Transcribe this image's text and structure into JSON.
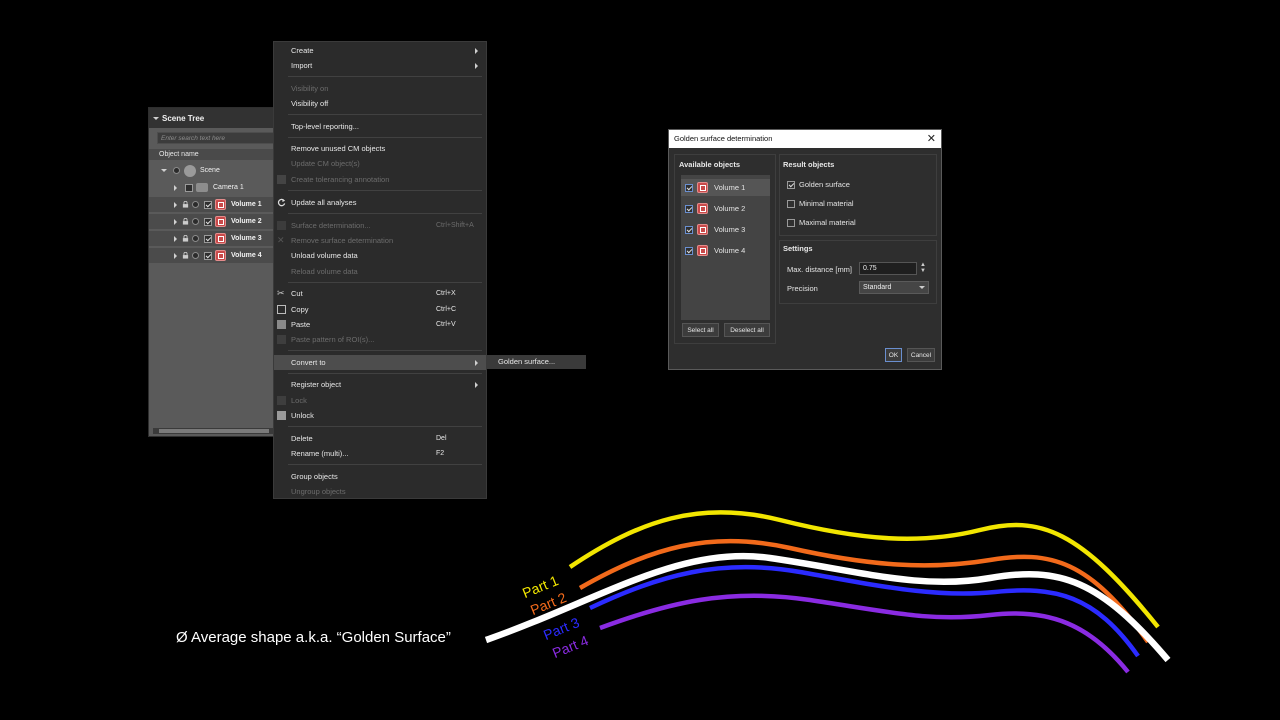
{
  "scene_tree": {
    "title": "Scene Tree",
    "search_placeholder": "Enter search text here",
    "column_header": "Object name",
    "items": [
      {
        "label": "Scene"
      },
      {
        "label": "Camera 1"
      },
      {
        "label": "Volume 1"
      },
      {
        "label": "Volume 2"
      },
      {
        "label": "Volume 3"
      },
      {
        "label": "Volume 4"
      }
    ]
  },
  "context_menu": {
    "items": [
      {
        "label": "Create",
        "submenu": true
      },
      {
        "label": "Import",
        "submenu": true
      },
      {
        "label": "Visibility on",
        "disabled": true
      },
      {
        "label": "Visibility off"
      },
      {
        "label": "Top-level reporting..."
      },
      {
        "label": "Remove unused CM objects"
      },
      {
        "label": "Update CM object(s)",
        "disabled": true
      },
      {
        "label": "Create tolerancing annotation",
        "disabled": true
      },
      {
        "label": "Update all analyses"
      },
      {
        "label": "Surface determination...",
        "shortcut": "Ctrl+Shift+A",
        "disabled": true
      },
      {
        "label": "Remove surface determination",
        "disabled": true
      },
      {
        "label": "Unload volume data"
      },
      {
        "label": "Reload volume data",
        "disabled": true
      },
      {
        "label": "Cut",
        "shortcut": "Ctrl+X"
      },
      {
        "label": "Copy",
        "shortcut": "Ctrl+C"
      },
      {
        "label": "Paste",
        "shortcut": "Ctrl+V"
      },
      {
        "label": "Paste pattern of ROI(s)...",
        "disabled": true
      },
      {
        "label": "Convert to",
        "submenu": true,
        "highlighted": true
      },
      {
        "label": "Register object",
        "submenu": true
      },
      {
        "label": "Lock",
        "disabled": true
      },
      {
        "label": "Unlock"
      },
      {
        "label": "Delete",
        "shortcut": "Del"
      },
      {
        "label": "Rename (multi)...",
        "shortcut": "F2"
      },
      {
        "label": "Group objects"
      },
      {
        "label": "Ungroup objects",
        "disabled": true
      }
    ],
    "submenu_item": "Golden surface..."
  },
  "dialog": {
    "title": "Golden surface determination",
    "available_title": "Available objects",
    "available": [
      "Volume 1",
      "Volume 2",
      "Volume 3",
      "Volume 4"
    ],
    "select_all": "Select all",
    "deselect_all": "Deselect all",
    "result_title": "Result objects",
    "results": [
      {
        "label": "Golden surface",
        "checked": true
      },
      {
        "label": "Minimal material",
        "checked": false
      },
      {
        "label": "Maximal material",
        "checked": false
      }
    ],
    "settings_title": "Settings",
    "max_distance_label": "Max. distance [mm]",
    "max_distance_value": "0.75",
    "precision_label": "Precision",
    "precision_value": "Standard",
    "ok": "OK",
    "cancel": "Cancel"
  },
  "illustration": {
    "caption": "Ø Average shape a.k.a. “Golden Surface”",
    "parts": [
      {
        "label": "Part 1",
        "color": "#f2e600"
      },
      {
        "label": "Part 2",
        "color": "#f26a1b"
      },
      {
        "label": "Part 3",
        "color": "#2b2bff"
      },
      {
        "label": "Part 4",
        "color": "#8a2be2"
      }
    ]
  }
}
